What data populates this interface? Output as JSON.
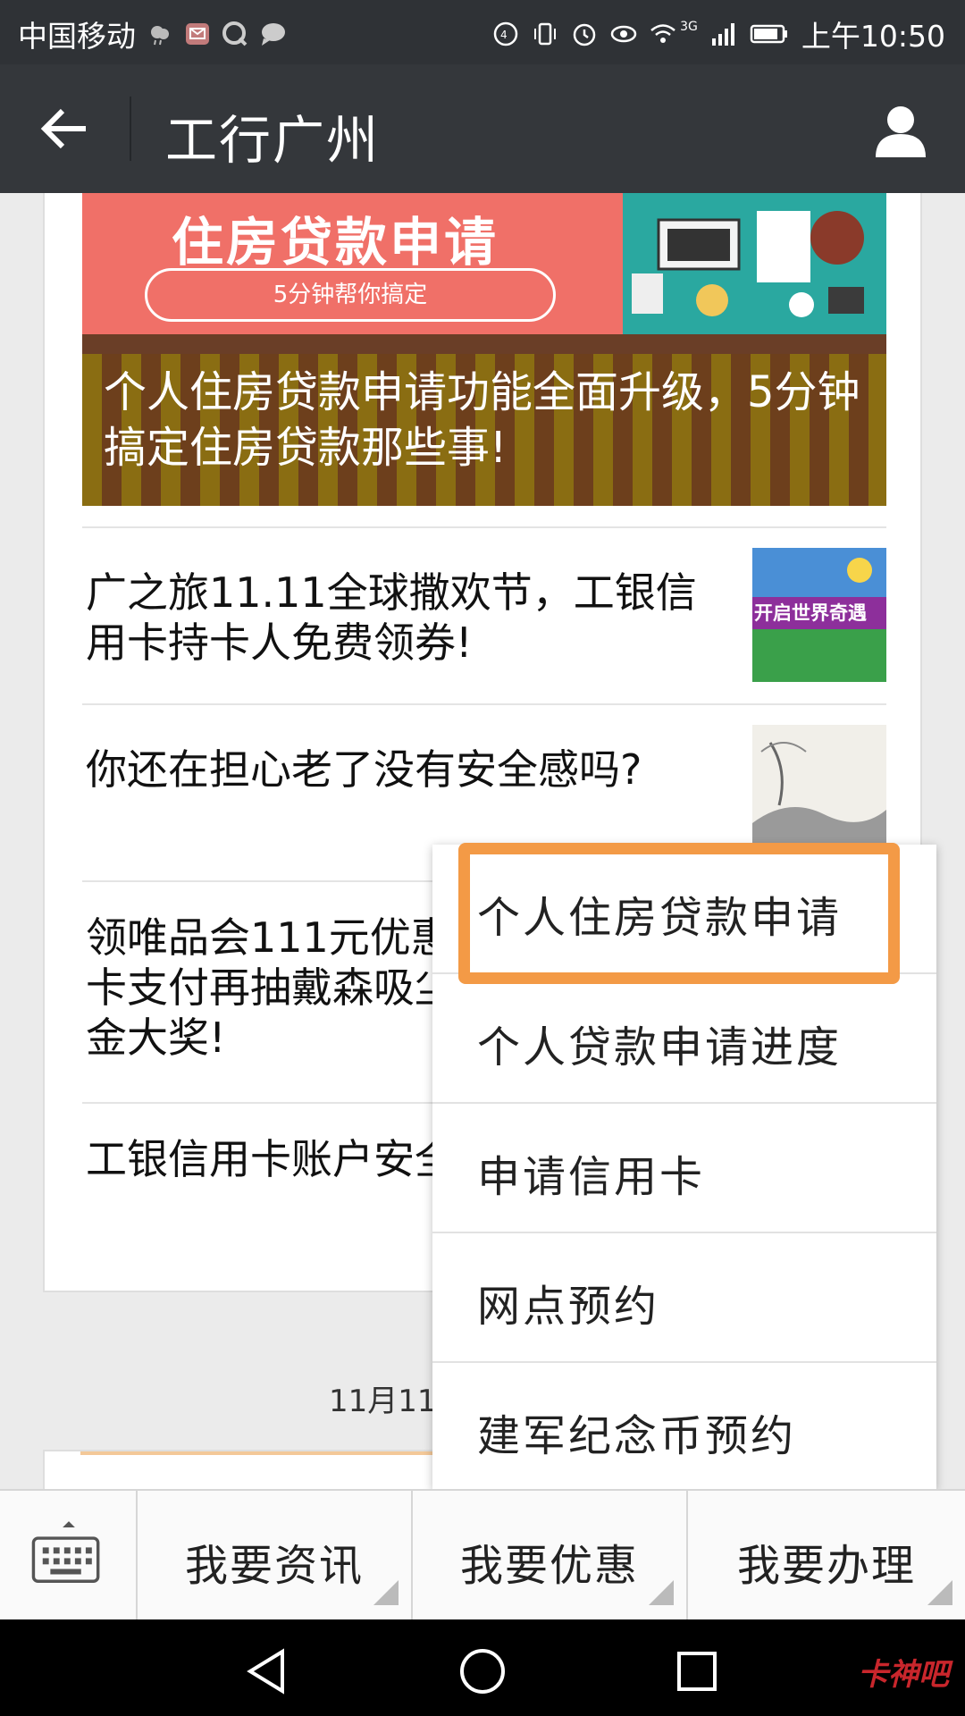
{
  "status_bar": {
    "carrier": "中国移动",
    "time": "上午10:50",
    "network": "3G",
    "left_icons": [
      "weather-icon",
      "mail-notification-icon",
      "qq-icon",
      "chat-bubble-icon"
    ],
    "right_icons": [
      "hd-icon",
      "vibrate-icon",
      "alarm-icon",
      "eye-icon",
      "wifi-icon",
      "signal-icon",
      "battery-icon"
    ]
  },
  "header": {
    "title": "工行广州",
    "back_icon": "arrow-left-icon",
    "profile_icon": "person-icon"
  },
  "banner": {
    "heading": "住房贷款申请",
    "pill": "5分钟帮你搞定",
    "caption": "个人住房贷款申请功能全面升级，5分钟搞定住房贷款那些事!"
  },
  "articles": [
    {
      "title": "广之旅11.11全球撒欢节，工银信用卡持卡人免费领券!",
      "thumb_text": "开启世界奇遇"
    },
    {
      "title": "你还在担心老了没有安全感吗?"
    },
    {
      "title": "领唯品会111元优惠券，工银信用卡支付再抽戴森吸尘器和万元购物金大奖!"
    },
    {
      "title": "工银信用卡账户安全锁重磅上线!"
    }
  ],
  "date_label": "11月11日",
  "popup_menu": {
    "items": [
      {
        "label": "个人住房贷款申请",
        "highlighted": true
      },
      {
        "label": "个人贷款申请进度"
      },
      {
        "label": "申请信用卡"
      },
      {
        "label": "网点预约"
      },
      {
        "label": "建军纪念币预约"
      }
    ],
    "highlight_color": "#f39a46"
  },
  "tab_bar": {
    "keyboard_icon": "keyboard-icon",
    "tabs": [
      {
        "label": "我要资讯"
      },
      {
        "label": "我要优惠"
      },
      {
        "label": "我要办理"
      }
    ]
  },
  "nav_bar": {
    "icons": [
      "back-triangle-icon",
      "home-circle-icon",
      "recents-square-icon"
    ],
    "watermark": "卡神吧"
  },
  "colors": {
    "header_bg": "#34373b",
    "status_bg": "#2f3236",
    "banner_pink": "#f07068",
    "accent_orange": "#f39a46"
  }
}
